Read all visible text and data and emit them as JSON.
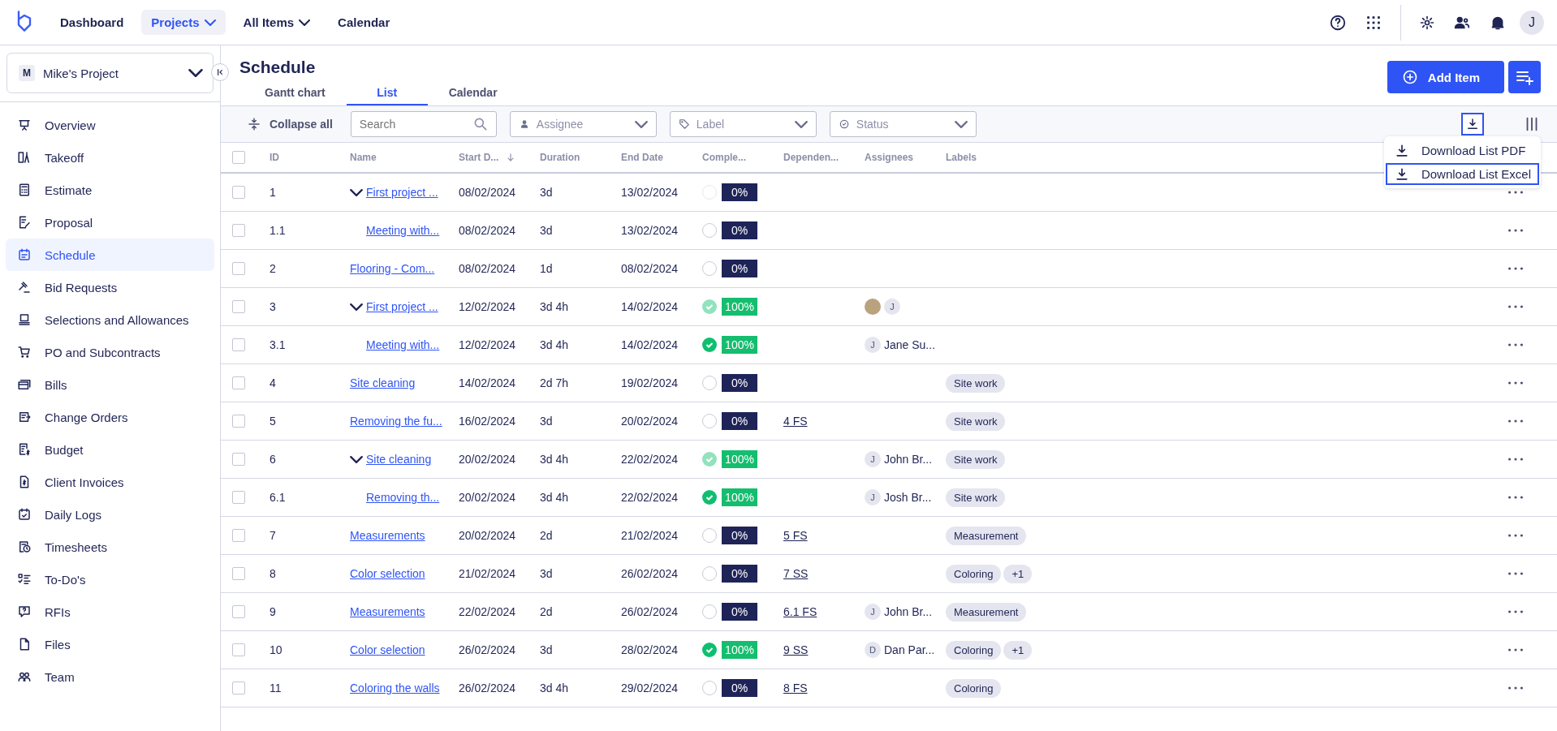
{
  "topnav": {
    "items": [
      {
        "label": "Dashboard",
        "selected": false,
        "dropdown": false
      },
      {
        "label": "Projects",
        "selected": true,
        "dropdown": true
      },
      {
        "label": "All Items",
        "selected": false,
        "dropdown": true
      },
      {
        "label": "Calendar",
        "selected": false,
        "dropdown": false
      }
    ],
    "avatar": "J"
  },
  "sidebar": {
    "project": {
      "initial": "M",
      "name": "Mike's Project"
    },
    "items": [
      {
        "label": "Overview",
        "selected": false
      },
      {
        "label": "Takeoff",
        "selected": false
      },
      {
        "label": "Estimate",
        "selected": false
      },
      {
        "label": "Proposal",
        "selected": false
      },
      {
        "label": "Schedule",
        "selected": true
      },
      {
        "label": "Bid Requests",
        "selected": false
      },
      {
        "label": "Selections and Allowances",
        "selected": false
      },
      {
        "label": "PO and Subcontracts",
        "selected": false
      },
      {
        "label": "Bills",
        "selected": false
      },
      {
        "label": "Change Orders",
        "selected": false
      },
      {
        "label": "Budget",
        "selected": false
      },
      {
        "label": "Client Invoices",
        "selected": false
      },
      {
        "label": "Daily Logs",
        "selected": false
      },
      {
        "label": "Timesheets",
        "selected": false
      },
      {
        "label": "To-Do's",
        "selected": false
      },
      {
        "label": "RFIs",
        "selected": false
      },
      {
        "label": "Files",
        "selected": false
      },
      {
        "label": "Team",
        "selected": false
      }
    ]
  },
  "page": {
    "title": "Schedule",
    "add_button": "Add Item",
    "tabs": [
      {
        "label": "Gantt chart",
        "selected": false
      },
      {
        "label": "List",
        "selected": true
      },
      {
        "label": "Calendar",
        "selected": false
      }
    ]
  },
  "toolbar": {
    "collapse": "Collapse all",
    "search": {
      "placeholder": "Search"
    },
    "filters": [
      {
        "kind": "person",
        "placeholder": "Assignee"
      },
      {
        "kind": "tag",
        "placeholder": "Label"
      },
      {
        "kind": "status",
        "placeholder": "Status"
      }
    ]
  },
  "download_menu": {
    "items": [
      {
        "label": "Download List PDF",
        "selected": false
      },
      {
        "label": "Download List Excel",
        "selected": true
      }
    ]
  },
  "table": {
    "select_all_checked": false,
    "columns": [
      "ID",
      "Name",
      "Start D...",
      "Duration",
      "End Date",
      "Comple...",
      "Dependen...",
      "Assignees",
      "Labels"
    ],
    "rows": [
      {
        "checked": false,
        "id": "1",
        "name": "First project ...",
        "start": "08/02/2024",
        "duration": "3d",
        "end": "13/02/2024",
        "done": false,
        "percent": "0%",
        "expanded": true,
        "children": [
          {
            "checked": false,
            "id": "1.1",
            "name": "Meeting with...",
            "start": "08/02/2024",
            "duration": "3d",
            "end": "13/02/2024",
            "done": false,
            "percent": "0%"
          }
        ]
      },
      {
        "checked": false,
        "id": "2",
        "name": "Flooring - Com...",
        "start": "08/02/2024",
        "duration": "1d",
        "end": "08/02/2024",
        "done": false,
        "percent": "0%"
      },
      {
        "checked": false,
        "id": "3",
        "name": "First project ...",
        "start": "12/02/2024",
        "duration": "3d 4h",
        "end": "14/02/2024",
        "done": true,
        "percent": "100%",
        "assignees": [
          {
            "kind": "photo"
          },
          {
            "kind": "initial",
            "initial": "J"
          }
        ],
        "expanded": true,
        "children": [
          {
            "checked": false,
            "id": "3.1",
            "name": "Meeting with...",
            "start": "12/02/2024",
            "duration": "3d 4h",
            "end": "14/02/2024",
            "done": true,
            "percent": "100%",
            "assignees": [
              {
                "kind": "initial",
                "initial": "J",
                "name": "Jane Su..."
              }
            ]
          }
        ]
      },
      {
        "checked": false,
        "id": "4",
        "name": "Site cleaning",
        "start": "14/02/2024",
        "duration": "2d 7h",
        "end": "19/02/2024",
        "done": false,
        "percent": "0%",
        "labels": [
          "Site work"
        ]
      },
      {
        "checked": false,
        "id": "5",
        "name": "Removing the fu...",
        "start": "16/02/2024",
        "duration": "3d",
        "end": "20/02/2024",
        "done": false,
        "percent": "0%",
        "dependency": "4 FS",
        "labels": [
          "Site work"
        ]
      },
      {
        "checked": false,
        "id": "6",
        "name": "Site cleaning",
        "start": "20/02/2024",
        "duration": "3d 4h",
        "end": "22/02/2024",
        "done": true,
        "percent": "100%",
        "assignees": [
          {
            "kind": "initial",
            "initial": "J",
            "name": "John Br..."
          }
        ],
        "labels": [
          "Site work"
        ],
        "expanded": true,
        "children": [
          {
            "checked": false,
            "id": "6.1",
            "name": "Removing th...",
            "start": "20/02/2024",
            "duration": "3d 4h",
            "end": "22/02/2024",
            "done": true,
            "percent": "100%",
            "assignees": [
              {
                "kind": "initial",
                "initial": "J",
                "name": "Josh Br..."
              }
            ],
            "labels": [
              "Site work"
            ]
          }
        ]
      },
      {
        "checked": false,
        "id": "7",
        "name": "Measurements",
        "start": "20/02/2024",
        "duration": "2d",
        "end": "21/02/2024",
        "done": false,
        "percent": "0%",
        "dependency": "5 FS",
        "labels": [
          "Measurement"
        ]
      },
      {
        "checked": false,
        "id": "8",
        "name": "Color selection",
        "start": "21/02/2024",
        "duration": "3d",
        "end": "26/02/2024",
        "done": false,
        "percent": "0%",
        "dependency": "7 SS",
        "labels": [
          "Coloring",
          "+1"
        ]
      },
      {
        "checked": false,
        "id": "9",
        "name": "Measurements",
        "start": "22/02/2024",
        "duration": "2d",
        "end": "26/02/2024",
        "done": false,
        "percent": "0%",
        "dependency": "6.1 FS",
        "assignees": [
          {
            "kind": "initial",
            "initial": "J",
            "name": "John Br..."
          }
        ],
        "labels": [
          "Measurement"
        ]
      },
      {
        "checked": false,
        "id": "10",
        "name": "Color selection",
        "start": "26/02/2024",
        "duration": "3d",
        "end": "28/02/2024",
        "done": true,
        "percent": "100%",
        "dependency": "9 SS",
        "assignees": [
          {
            "kind": "initial",
            "initial": "D",
            "name": "Dan Par..."
          }
        ],
        "labels": [
          "Coloring",
          "+1"
        ]
      },
      {
        "checked": false,
        "id": "11",
        "name": "Coloring the walls",
        "start": "26/02/2024",
        "duration": "3d 4h",
        "end": "29/02/2024",
        "done": false,
        "percent": "0%",
        "dependency": "8 FS",
        "labels": [
          "Coloring"
        ]
      }
    ]
  }
}
